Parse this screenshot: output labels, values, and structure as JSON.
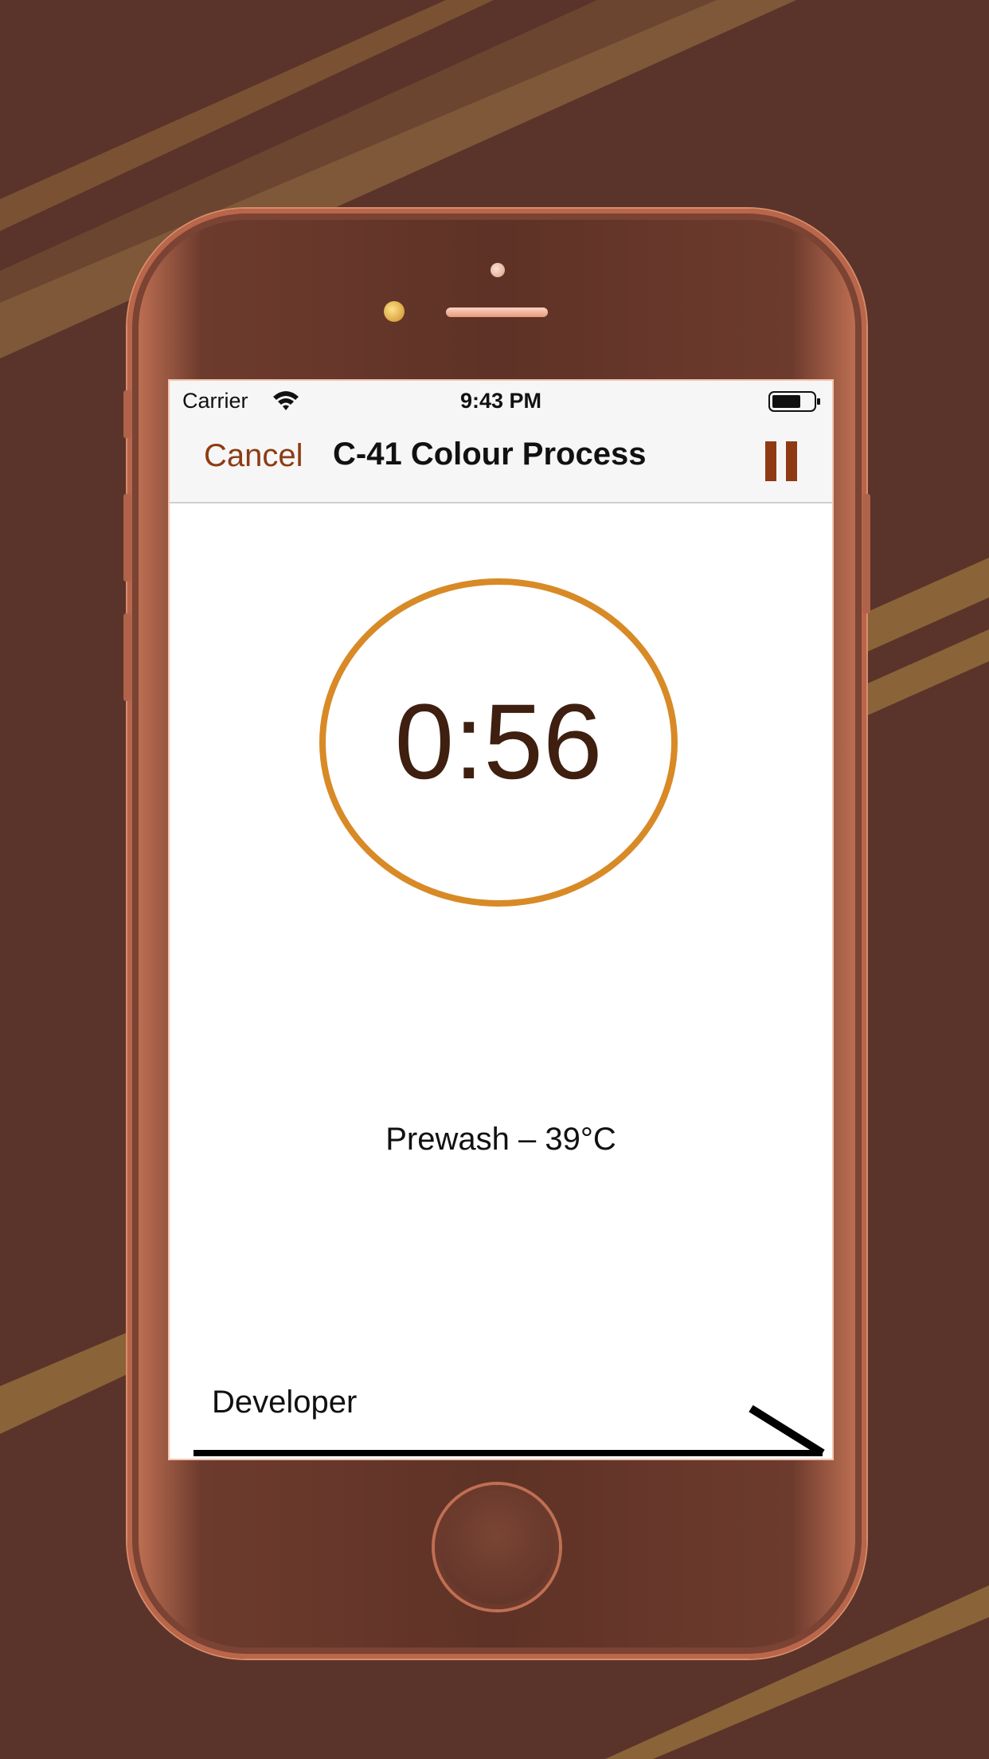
{
  "status_bar": {
    "carrier": "Carrier",
    "time": "9:43 PM",
    "battery_level": 0.7
  },
  "nav": {
    "cancel_label": "Cancel",
    "title": "C-41 Colour Process",
    "pause_icon": "pause-icon"
  },
  "timer": {
    "value": "0:56"
  },
  "current_step": {
    "label": "Prewash – 39°C"
  },
  "next_step": {
    "label": "Developer"
  },
  "colors": {
    "background": "#5a342a",
    "accent": "#8e3b14",
    "timer_ring": "#d88a26",
    "timer_text": "#3e1f10"
  }
}
